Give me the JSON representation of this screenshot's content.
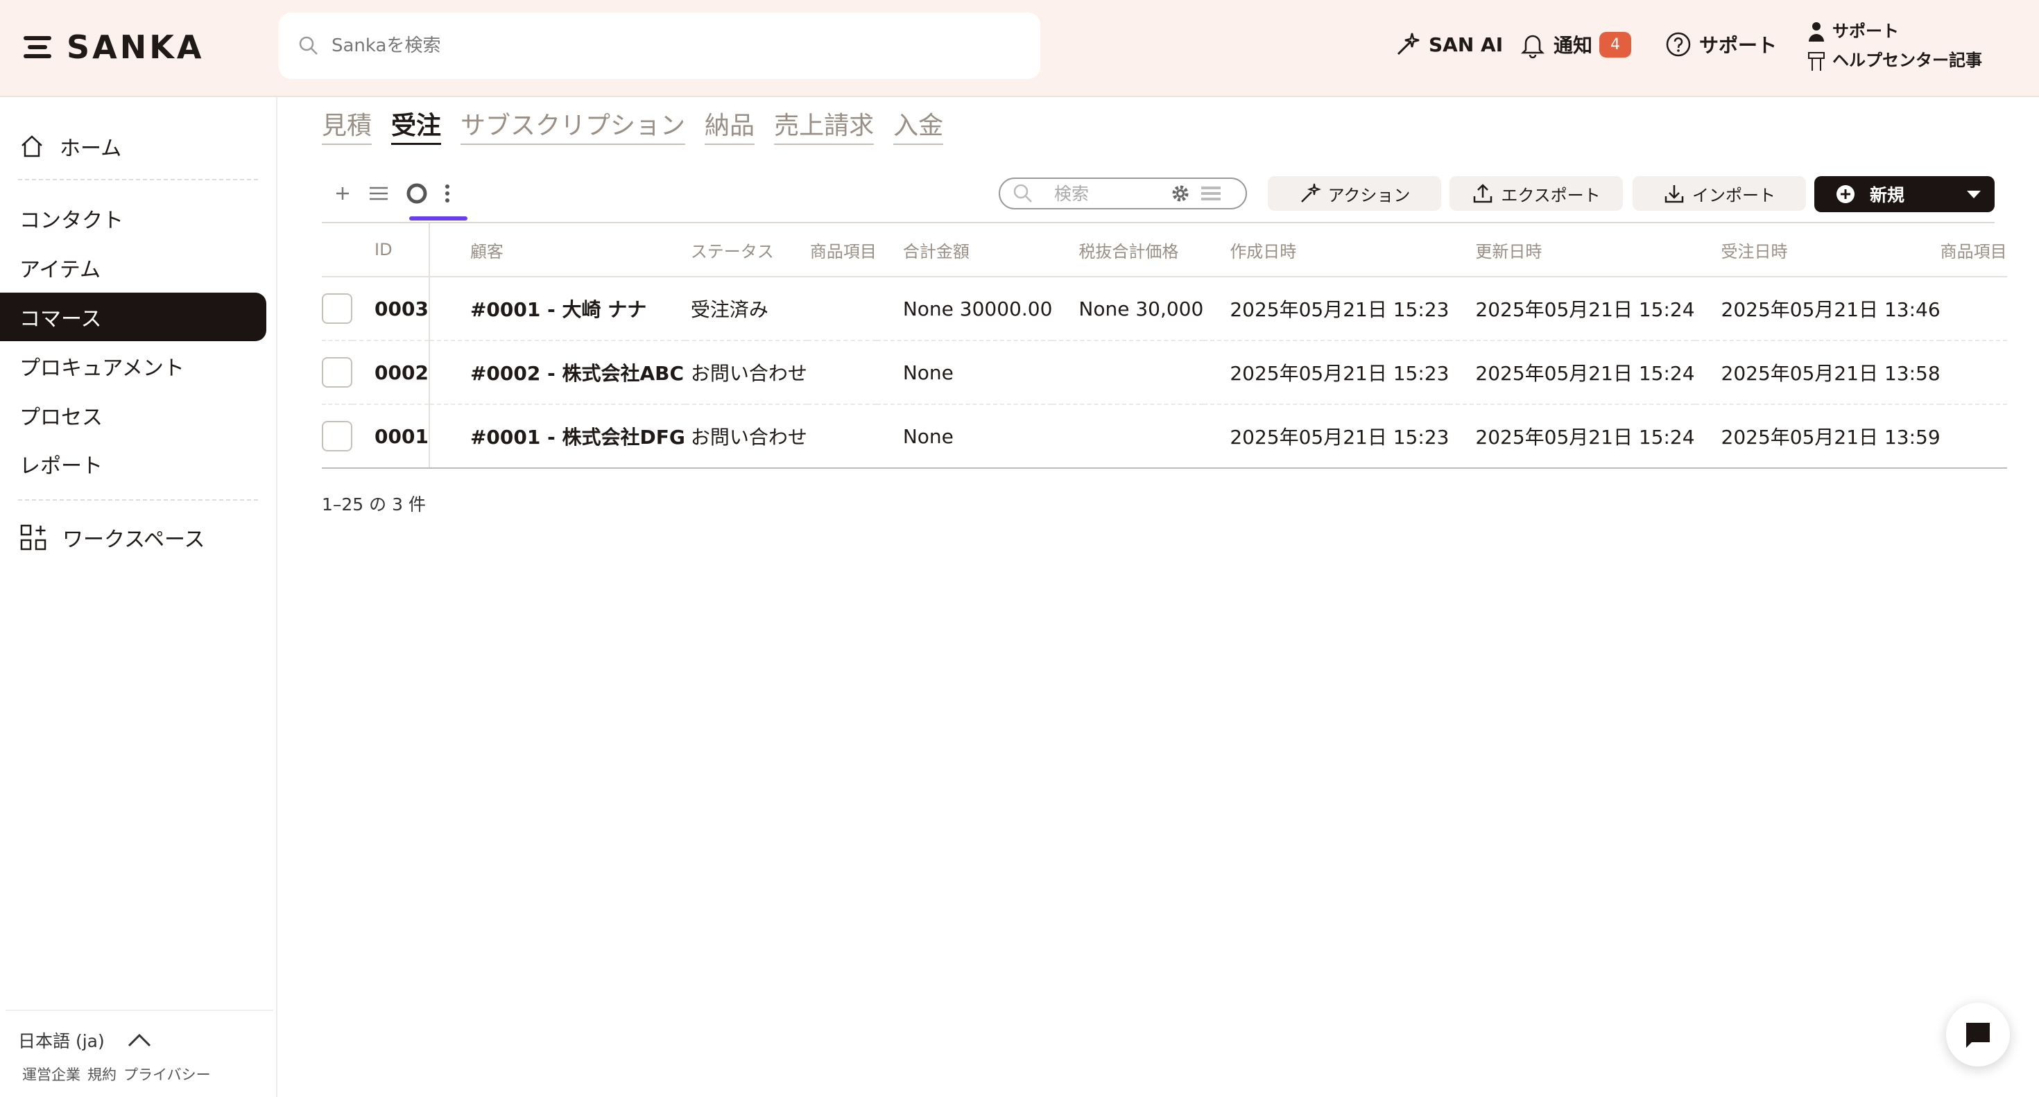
{
  "header": {
    "logo_text": "SANKA",
    "search_placeholder": "Sankaを検索",
    "san_ai_label": "SAN AI",
    "notifications_label": "通知",
    "notifications_count": "4",
    "support_label": "サポート",
    "support_stack_top": "サポート",
    "help_center_label": "ヘルプセンター記事"
  },
  "sidebar": {
    "home": "ホーム",
    "items": [
      "コンタクト",
      "アイテム",
      "コマース",
      "プロキュアメント",
      "プロセス",
      "レポート"
    ],
    "active_index": 2,
    "workspace": "ワークスペース",
    "language": "日本語 (ja)",
    "legal": [
      "運営企業",
      "規約",
      "プライバシー"
    ]
  },
  "module_tabs": [
    "見積",
    "受注",
    "サブスクリプション",
    "納品",
    "売上請求",
    "入金"
  ],
  "active_module_tab": "受注",
  "toolbar": {
    "search_placeholder": "検索",
    "action_label": "アクション",
    "export_label": "エクスポート",
    "import_label": "インポート",
    "new_label": "新規"
  },
  "table": {
    "columns": [
      "ID",
      "顧客",
      "ステータス",
      "商品項目",
      "合計金額",
      "税抜合計価格",
      "作成日時",
      "更新日時",
      "受注日時",
      "商品項目"
    ],
    "rows": [
      {
        "id": "0003",
        "customer": "#0001 - 大崎 ナナ",
        "status": "受注済み",
        "items": "",
        "total": "None 30000.00",
        "subtotal": "None 30,000",
        "created": "2025年05月21日 15:23",
        "updated": "2025年05月21日 15:24",
        "ordered": "2025年05月21日 13:46",
        "items2": ""
      },
      {
        "id": "0002",
        "customer": "#0002 - 株式会社ABC",
        "status": "お問い合わせ",
        "items": "",
        "total": "None",
        "subtotal": "",
        "created": "2025年05月21日 15:23",
        "updated": "2025年05月21日 15:24",
        "ordered": "2025年05月21日 13:58",
        "items2": ""
      },
      {
        "id": "0001",
        "customer": "#0001 - 株式会社DFG",
        "status": "お問い合わせ",
        "items": "",
        "total": "None",
        "subtotal": "",
        "created": "2025年05月21日 15:23",
        "updated": "2025年05月21日 15:24",
        "ordered": "2025年05月21日 13:59",
        "items2": ""
      }
    ],
    "count_text": "1–25 の 3 件"
  },
  "colors": {
    "header_bg": "#fcf1ed",
    "active_nav_bg": "#1c1412",
    "badge_bg": "#e2603e",
    "view_underline": "#6a3df0"
  }
}
